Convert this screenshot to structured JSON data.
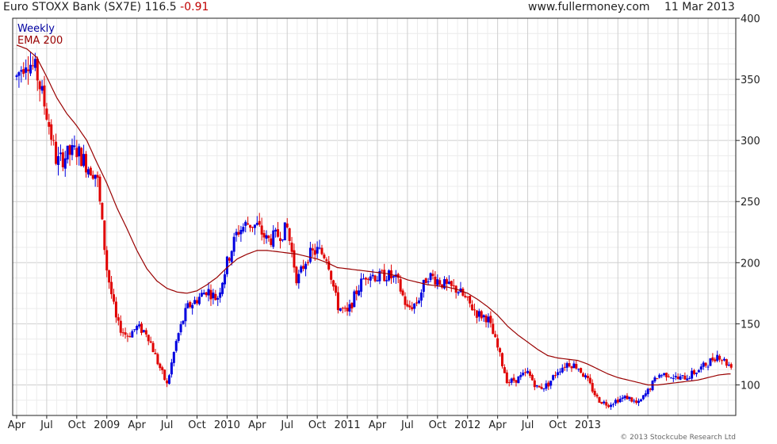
{
  "header": {
    "instrument": "Euro STOXX Bank (SX7E)",
    "last": "116.5",
    "change": "-0.91",
    "website": "www.fullermoney.com",
    "date": "11 Mar 2013"
  },
  "legend": {
    "period": "Weekly",
    "indicator": "EMA 200"
  },
  "copyright": "© 2013 Stockcube Research Ltd",
  "colors": {
    "up": "#0000e0",
    "down": "#e00000",
    "ema": "#990000",
    "legend_period": "#0000a0",
    "legend_indicator": "#990000",
    "grid": "#d8d8d8",
    "frame": "#222222"
  },
  "chart_data": {
    "type": "candlestick",
    "title": "Euro STOXX Bank (SX7E)",
    "period": "Weekly",
    "x_range": [
      "2007-04",
      "2013-03"
    ],
    "y_range": [
      75,
      400
    ],
    "y_ticks": [
      100,
      150,
      200,
      250,
      300,
      350,
      400
    ],
    "x_ticks": [
      {
        "label": "Apr",
        "date": "2007-04"
      },
      {
        "label": "Jul",
        "date": "2007-07"
      },
      {
        "label": "Oct",
        "date": "2007-10"
      },
      {
        "label": "2009",
        "date": "2008-01"
      },
      {
        "label": "Apr",
        "date": "2008-04"
      },
      {
        "label": "Jul",
        "date": "2008-07"
      },
      {
        "label": "Oct",
        "date": "2008-10"
      },
      {
        "label": "2010",
        "date": "2009-01"
      },
      {
        "label": "Apr",
        "date": "2009-04"
      },
      {
        "label": "Jul",
        "date": "2009-07"
      },
      {
        "label": "Oct",
        "date": "2009-10"
      },
      {
        "label": "2011",
        "date": "2010-01"
      },
      {
        "label": "Apr",
        "date": "2010-04"
      },
      {
        "label": "Jul",
        "date": "2010-07"
      },
      {
        "label": "Oct",
        "date": "2010-10"
      },
      {
        "label": "2012",
        "date": "2011-01"
      },
      {
        "label": "Apr",
        "date": "2011-04"
      },
      {
        "label": "Jul",
        "date": "2011-07"
      },
      {
        "label": "Oct",
        "date": "2011-10"
      },
      {
        "label": "2013",
        "date": "2012-01"
      }
    ],
    "price_path": [
      [
        "2007-04",
        352
      ],
      [
        "2007-05",
        368
      ],
      [
        "2007-06",
        355
      ],
      [
        "2007-07",
        322
      ],
      [
        "2007-08",
        282
      ],
      [
        "2007-09",
        288
      ],
      [
        "2007-10",
        292
      ],
      [
        "2007-11",
        280
      ],
      [
        "2007-12",
        272
      ],
      [
        "2008-01",
        195
      ],
      [
        "2008-02",
        150
      ],
      [
        "2008-03",
        140
      ],
      [
        "2008-04",
        147
      ],
      [
        "2008-05",
        143
      ],
      [
        "2008-06",
        120
      ],
      [
        "2008-07",
        100
      ],
      [
        "2008-08",
        138
      ],
      [
        "2008-09",
        163
      ],
      [
        "2008-10",
        170
      ],
      [
        "2008-11",
        178
      ],
      [
        "2008-12",
        170
      ],
      [
        "2009-01",
        200
      ],
      [
        "2009-02",
        225
      ],
      [
        "2009-03",
        232
      ],
      [
        "2009-04",
        230
      ],
      [
        "2009-05",
        218
      ],
      [
        "2009-06",
        222
      ],
      [
        "2009-07",
        228
      ],
      [
        "2009-08",
        185
      ],
      [
        "2009-09",
        205
      ],
      [
        "2009-10",
        210
      ],
      [
        "2009-11",
        205
      ],
      [
        "2009-12",
        165
      ],
      [
        "2010-01",
        158
      ],
      [
        "2010-02",
        178
      ],
      [
        "2010-03",
        192
      ],
      [
        "2010-04",
        188
      ],
      [
        "2010-05",
        190
      ],
      [
        "2010-06",
        185
      ],
      [
        "2010-07",
        162
      ],
      [
        "2010-08",
        168
      ],
      [
        "2010-09",
        190
      ],
      [
        "2010-10",
        186
      ],
      [
        "2010-11",
        180
      ],
      [
        "2010-12",
        178
      ],
      [
        "2011-01",
        168
      ],
      [
        "2011-02",
        158
      ],
      [
        "2011-03",
        155
      ],
      [
        "2011-04",
        130
      ],
      [
        "2011-05",
        102
      ],
      [
        "2011-06",
        105
      ],
      [
        "2011-07",
        110
      ],
      [
        "2011-08",
        97
      ],
      [
        "2011-09",
        100
      ],
      [
        "2011-10",
        112
      ],
      [
        "2011-11",
        118
      ],
      [
        "2011-12",
        115
      ],
      [
        "2012-01",
        103
      ],
      [
        "2012-02",
        88
      ],
      [
        "2012-03",
        84
      ],
      [
        "2012-04",
        88
      ],
      [
        "2012-05",
        90
      ],
      [
        "2012-06",
        84
      ],
      [
        "2012-07",
        95
      ],
      [
        "2012-08",
        108
      ],
      [
        "2012-09",
        109
      ],
      [
        "2012-10",
        105
      ],
      [
        "2012-11",
        107
      ],
      [
        "2012-12",
        112
      ],
      [
        "2013-01",
        118
      ],
      [
        "2013-02",
        125
      ],
      [
        "2013-03",
        116.5
      ]
    ],
    "ema200": [
      [
        "2007-04",
        378
      ],
      [
        "2007-05",
        375
      ],
      [
        "2007-06",
        368
      ],
      [
        "2007-07",
        352
      ],
      [
        "2007-08",
        335
      ],
      [
        "2007-09",
        322
      ],
      [
        "2007-10",
        312
      ],
      [
        "2007-11",
        300
      ],
      [
        "2007-12",
        282
      ],
      [
        "2008-01",
        265
      ],
      [
        "2008-02",
        245
      ],
      [
        "2008-03",
        228
      ],
      [
        "2008-04",
        210
      ],
      [
        "2008-05",
        195
      ],
      [
        "2008-06",
        185
      ],
      [
        "2008-07",
        179
      ],
      [
        "2008-08",
        176
      ],
      [
        "2008-09",
        175
      ],
      [
        "2008-10",
        177
      ],
      [
        "2008-11",
        182
      ],
      [
        "2008-12",
        188
      ],
      [
        "2009-01",
        196
      ],
      [
        "2009-02",
        203
      ],
      [
        "2009-03",
        207
      ],
      [
        "2009-04",
        210
      ],
      [
        "2009-05",
        210
      ],
      [
        "2009-06",
        209
      ],
      [
        "2009-07",
        208
      ],
      [
        "2009-08",
        207
      ],
      [
        "2009-09",
        205
      ],
      [
        "2009-10",
        203
      ],
      [
        "2009-11",
        200
      ],
      [
        "2009-12",
        196
      ],
      [
        "2010-01",
        195
      ],
      [
        "2010-02",
        194
      ],
      [
        "2010-03",
        193
      ],
      [
        "2010-04",
        192
      ],
      [
        "2010-05",
        191
      ],
      [
        "2010-06",
        189
      ],
      [
        "2010-07",
        186
      ],
      [
        "2010-08",
        184
      ],
      [
        "2010-09",
        182
      ],
      [
        "2010-10",
        181
      ],
      [
        "2010-11",
        180
      ],
      [
        "2010-12",
        178
      ],
      [
        "2011-01",
        175
      ],
      [
        "2011-02",
        170
      ],
      [
        "2011-03",
        164
      ],
      [
        "2011-04",
        157
      ],
      [
        "2011-05",
        148
      ],
      [
        "2011-06",
        141
      ],
      [
        "2011-07",
        135
      ],
      [
        "2011-08",
        129
      ],
      [
        "2011-09",
        124
      ],
      [
        "2011-10",
        122
      ],
      [
        "2011-11",
        121
      ],
      [
        "2011-12",
        120
      ],
      [
        "2012-01",
        117
      ],
      [
        "2012-02",
        113
      ],
      [
        "2012-03",
        109
      ],
      [
        "2012-04",
        106
      ],
      [
        "2012-05",
        104
      ],
      [
        "2012-06",
        102
      ],
      [
        "2012-07",
        100
      ],
      [
        "2012-08",
        100
      ],
      [
        "2012-09",
        101
      ],
      [
        "2012-10",
        102
      ],
      [
        "2012-11",
        103
      ],
      [
        "2012-12",
        104
      ],
      [
        "2013-01",
        106
      ],
      [
        "2013-02",
        108
      ],
      [
        "2013-03",
        109
      ]
    ]
  }
}
